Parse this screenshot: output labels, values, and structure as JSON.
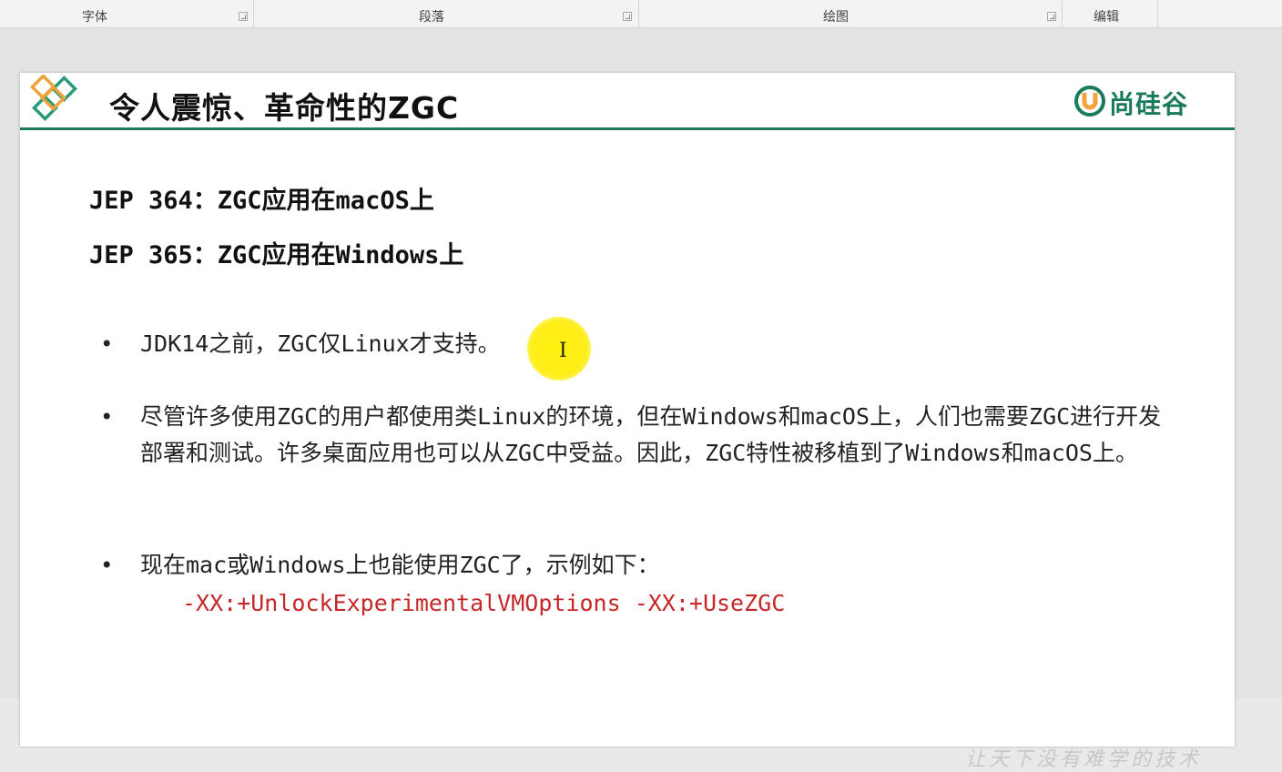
{
  "ribbon": {
    "groups": [
      {
        "label": "字体"
      },
      {
        "label": "段落"
      },
      {
        "label": "绘图"
      },
      {
        "label": "编辑"
      }
    ]
  },
  "slide": {
    "title": "令人震惊、革命性的ZGC",
    "brand": {
      "name": "尚硅谷",
      "icon": "u-logo-icon",
      "color": "#1a7a5c"
    },
    "accent_color": "#1a7a60",
    "jeps": [
      "JEP 364：ZGC应用在macOS上",
      "JEP 365：ZGC应用在Windows上"
    ],
    "bullet_symbol": "•",
    "bullets": [
      "JDK14之前，ZGC仅Linux才支持。",
      "尽管许多使用ZGC的用户都使用类Linux的环境，但在Windows和macOS上，人们也需要ZGC进行开发部署和测试。许多桌面应用也可以从ZGC中受益。因此，ZGC特性被移植到了Windows和macOS上。",
      "现在mac或Windows上也能使用ZGC了，示例如下："
    ],
    "code": "-XX:+UnlockExperimentalVMOptions -XX:+UseZGC",
    "code_color": "#c62828",
    "watermark": "让天下没有难学的技术"
  }
}
